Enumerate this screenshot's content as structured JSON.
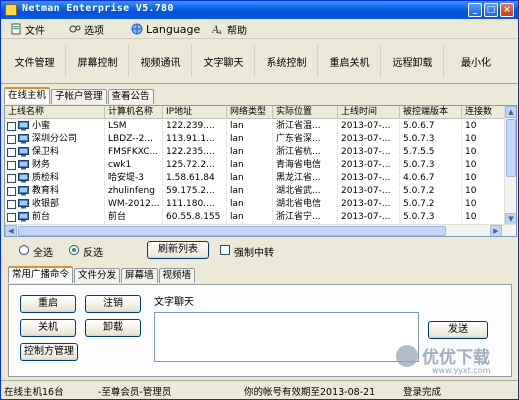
{
  "window": {
    "title": "Netman Enterprise V5.780",
    "controls": [
      "_",
      "□",
      "×"
    ]
  },
  "menu": [
    {
      "label": "文件",
      "icon": "file-icon"
    },
    {
      "label": "选项",
      "icon": "options-icon"
    },
    {
      "label": "Language",
      "icon": "language-icon"
    },
    {
      "label": "帮助",
      "icon": "help-icon"
    }
  ],
  "toolbar": [
    "文件管理",
    "屏幕控制",
    "视频通讯",
    "文字聊天",
    "系统控制",
    "重启关机",
    "远程卸载",
    "最小化"
  ],
  "top_tabs": [
    "在线主机",
    "子帐户管理",
    "查看公告"
  ],
  "grid": {
    "columns": [
      "上线名称",
      "计算机名称",
      "IP地址",
      "网络类型",
      "实际位置",
      "上线时间",
      "被控端版本",
      "连接数"
    ],
    "rows": [
      [
        "小蜜",
        "LSM",
        "122.239....",
        "lan",
        "浙江省温...",
        "2013-07-...",
        "5.0.6.7",
        "10"
      ],
      [
        "深圳分公司",
        "LBDZ--2...",
        "113.91.1...",
        "lan",
        "广东省深...",
        "2013-07-...",
        "5.0.7.3",
        "10"
      ],
      [
        "保卫科",
        "FMSFKXC...",
        "122.235....",
        "lan",
        "浙江省杭...",
        "2013-07-...",
        "5.7.5.5",
        "10"
      ],
      [
        "财务",
        "cwk1",
        "125.72.2...",
        "lan",
        "青海省电信",
        "2013-07-...",
        "5.0.7.3",
        "10"
      ],
      [
        "质检科",
        "哈安堤-3",
        "1.58.61.84",
        "lan",
        "黑龙江省...",
        "2013-07-...",
        "4.0.6.7",
        "10"
      ],
      [
        "教育科",
        "zhulinfeng",
        "59.175.2...",
        "lan",
        "湖北省武...",
        "2013-07-...",
        "5.0.7.2",
        "10"
      ],
      [
        "收银部",
        "WM-2012...",
        "111.180....",
        "lan",
        "湖北省电信",
        "2013-07-...",
        "5.0.7.2",
        "10"
      ],
      [
        "前台",
        "前台",
        "60.55.8.155",
        "lan",
        "浙江省宁...",
        "2013-07-...",
        "5.0.7.3",
        "10"
      ]
    ]
  },
  "selection": {
    "select_all": "全选",
    "invert": "反选",
    "refresh": "刷新列表",
    "force_relay": "强制中转"
  },
  "bottom_tabs": [
    "常用广播命令",
    "文件分发",
    "屏幕墙",
    "视频墙"
  ],
  "commands": {
    "restart": "重启",
    "logout": "注销",
    "shutdown": "关机",
    "uninstall": "卸载",
    "controller_mgmt": "控制方管理"
  },
  "chat": {
    "label": "文字聊天",
    "send": "发送"
  },
  "status": {
    "online": "在线主机16台",
    "account": "-至尊会员-管理员",
    "expiry": "你的帐号有效期至2013-08-21",
    "login": "登录完成"
  },
  "watermark": {
    "name": "优优下载",
    "url": "www.yyxt.com"
  },
  "colors": {
    "titlebar": "#0a5ee8",
    "tab_accent": "#e68b2c",
    "window_bg": "#ece9d8"
  }
}
